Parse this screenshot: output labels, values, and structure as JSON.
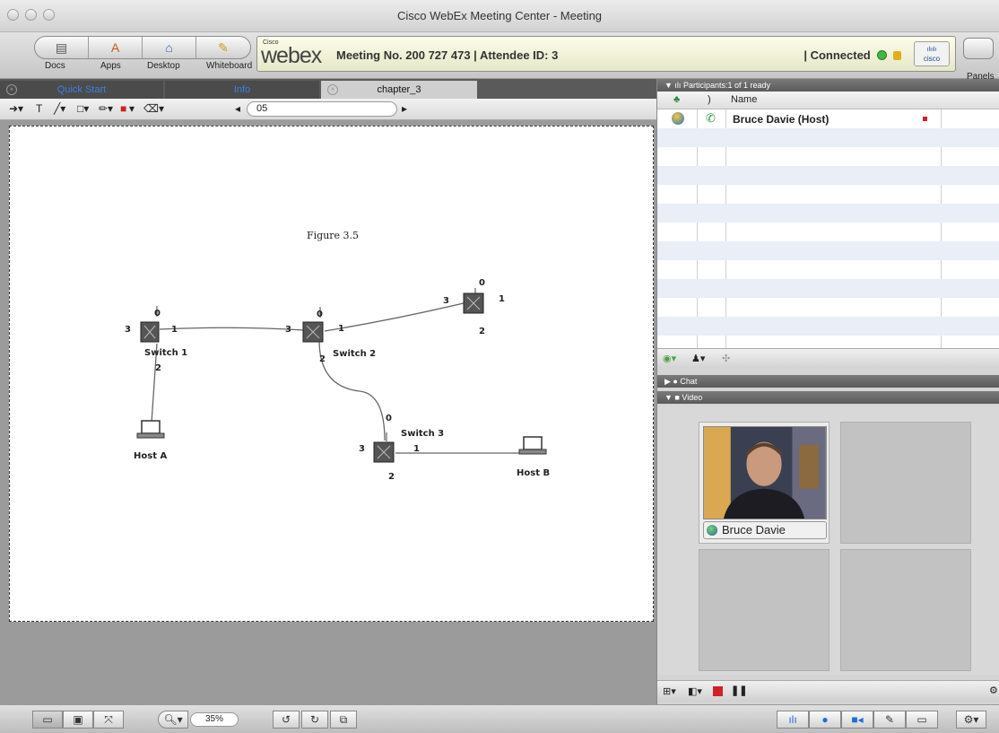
{
  "window": {
    "title": "Cisco WebEx Meeting Center - Meeting"
  },
  "toolbar": {
    "share_buttons": [
      "Docs",
      "Apps",
      "Desktop",
      "Whiteboard"
    ],
    "brand_small": "Cisco",
    "brand": "webex",
    "meeting_info": "Meeting No. 200 727 473 | Attendee ID: 3",
    "status": "| Connected",
    "cisco_logo_text": "cisco",
    "panels_label": "Panels"
  },
  "tabs": [
    {
      "label": "Quick Start"
    },
    {
      "label": "Info"
    },
    {
      "label": "chapter_3"
    }
  ],
  "annotation": {
    "page_value": "05"
  },
  "figure": {
    "caption": "Figure 3.5",
    "switch1": "Switch 1",
    "switch2": "Switch 2",
    "switch3": "Switch 3",
    "hostA": "Host A",
    "hostB": "Host B",
    "ports": {
      "s1_top": "0",
      "s1_left": "3",
      "s1_right": "1",
      "s1_bottom": "2",
      "s2_top": "0",
      "s2_left": "3",
      "s2_right": "1",
      "s2_bottom": "2",
      "s4_top": "0",
      "s4_left": "3",
      "s4_right": "1",
      "s4_bottom": "2",
      "s3_top": "0",
      "s3_left": "3",
      "s3_right": "1",
      "s3_bottom": "2"
    }
  },
  "participants": {
    "header": "Participants:1 of 1 ready",
    "col_name": "Name",
    "col_bracket": ")",
    "rows": [
      {
        "name": "Bruce Davie (Host)"
      }
    ]
  },
  "chat": {
    "header": "Chat"
  },
  "video": {
    "header": "Video",
    "tile_name": "Bruce Davie"
  },
  "bottom": {
    "zoom": "35%"
  },
  "colors": {
    "accent_blue": "#1d6fd0",
    "status_green": "#3fba3f",
    "host_red": "#d0202a"
  }
}
